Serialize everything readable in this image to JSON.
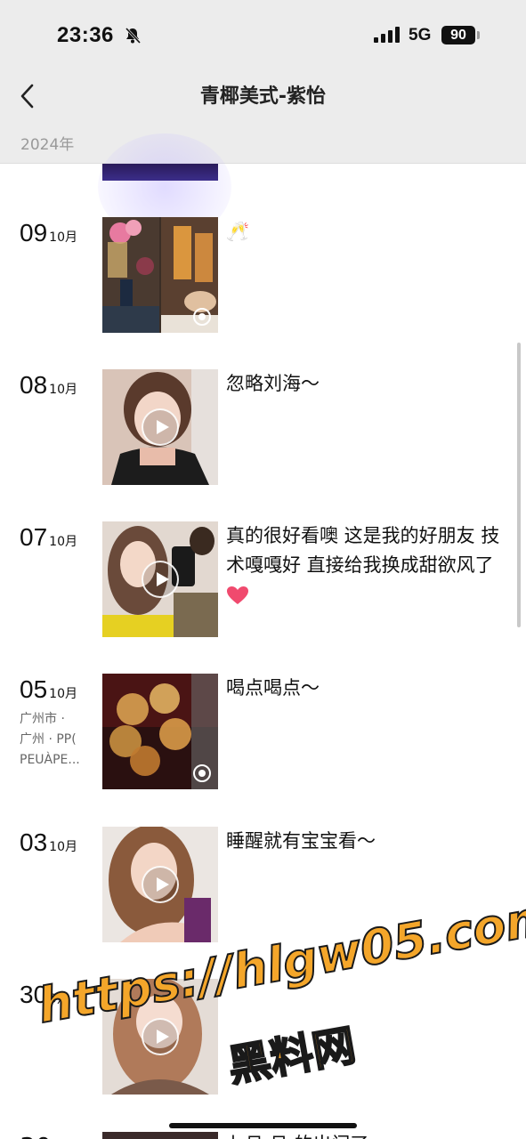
{
  "status_bar": {
    "time": "23:36",
    "network": "5G",
    "battery": "90"
  },
  "header": {
    "title": "青椰美式-紫怡",
    "year": "2024年"
  },
  "posts": [
    {
      "day": "09",
      "month": "10月",
      "location": "",
      "caption": "🥂",
      "media": "photo-grid"
    },
    {
      "day": "08",
      "month": "10月",
      "location": "",
      "caption": "忽略刘海～",
      "media": "video"
    },
    {
      "day": "07",
      "month": "10月",
      "location": "",
      "caption": "真的很好看噢 这是我的好朋友 技术嘎嘎好 直接给我换成甜欲风了",
      "media": "video"
    },
    {
      "day": "05",
      "month": "10月",
      "location_lines": [
        "广州市 ·",
        "广州 · PP(",
        "PEUÀPE..."
      ],
      "caption": "喝点喝点～",
      "media": "live-photo"
    },
    {
      "day": "03",
      "month": "10月",
      "location": "",
      "caption": "睡醒就有宝宝看～",
      "media": "video"
    },
    {
      "day": "30",
      "month": "9月",
      "location": "",
      "caption": "",
      "media": "video"
    }
  ],
  "next_caption": "七月 月 的出门了",
  "watermark": {
    "url": "https://hlgw05.com",
    "name": "黑料网"
  },
  "colors": {
    "header_bg": "#ececec",
    "watermark": "#f4a62a",
    "heart": "#f04a6e"
  }
}
